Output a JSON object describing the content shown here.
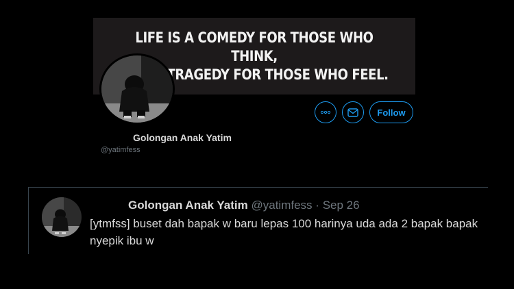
{
  "profile": {
    "banner_lines": [
      "LIFE IS A COMEDY FOR THOSE WHO THINK,",
      "AND A TRAGEDY FOR THOSE WHO FEEL."
    ],
    "name": "Golongan Anak Yatim",
    "handle": "@yatimfess",
    "actions": {
      "more_icon": "more-icon",
      "message_icon": "envelope-icon",
      "follow_label": "Follow"
    }
  },
  "tweet": {
    "author": "Golongan Anak Yatim",
    "handle": "@yatimfess",
    "separator": "·",
    "date": "Sep 26",
    "text": "[ytmfss] buset dah bapak w baru lepas 100 harinya uda ada 2 bapak bapak nyepik ibu w"
  },
  "colors": {
    "background": "#000000",
    "accent": "#1d9bf0",
    "primary_text": "#d9d9d9",
    "secondary_text": "#6e767d",
    "divider": "#38444d"
  }
}
